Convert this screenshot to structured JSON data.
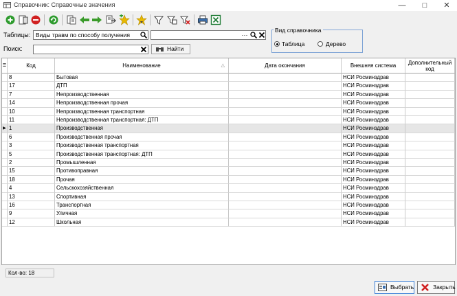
{
  "window": {
    "title": "Справочник: Справочные значения",
    "controls": [
      "minimize",
      "maximize",
      "close"
    ]
  },
  "toolbar": {
    "buttons": [
      "add-icon",
      "edit-icon",
      "delete-icon",
      "refresh-icon",
      "copy-icon",
      "arrow-left-icon",
      "arrow-right-icon",
      "export-icon",
      "star-add-icon",
      "star-down-icon",
      "filter-icon",
      "filter-edit-icon",
      "filter-clear-icon",
      "print-icon",
      "excel-icon"
    ]
  },
  "filters": {
    "table_label": "Таблицы:",
    "table_value": "Виды травм по способу получения",
    "second_value": "",
    "search_label": "Поиск:",
    "search_value": "",
    "find_button": "Найти"
  },
  "view_mode": {
    "title": "Вид справочника",
    "options": [
      "Таблица",
      "Дерево"
    ],
    "selected": "Таблица"
  },
  "grid": {
    "columns": [
      "Код",
      "Наименование",
      "Дата окончания",
      "Внешняя система",
      "Дополнительный код"
    ],
    "sort_column": "Наименование",
    "selected_row": 6,
    "rows": [
      [
        "8",
        "Бытовая",
        "",
        "НСИ Росминздрав",
        ""
      ],
      [
        "17",
        "ДТП",
        "",
        "НСИ Росминздрав",
        ""
      ],
      [
        "7",
        "Непроизводственная",
        "",
        "НСИ Росминздрав",
        ""
      ],
      [
        "14",
        "Непроизводственная прочая",
        "",
        "НСИ Росминздрав",
        ""
      ],
      [
        "10",
        "Непроизводственная транспортная",
        "",
        "НСИ Росминздрав",
        ""
      ],
      [
        "11",
        "Непроизводственная транспортная: ДТП",
        "",
        "НСИ Росминздрав",
        ""
      ],
      [
        "1",
        "Производственная",
        "",
        "НСИ Росминздрав",
        ""
      ],
      [
        "6",
        "Производственная прочая",
        "",
        "НСИ Росминздрав",
        ""
      ],
      [
        "3",
        "Производственная транспортная",
        "",
        "НСИ Росминздрав",
        ""
      ],
      [
        "5",
        "Производственная транспортная: ДТП",
        "",
        "НСИ Росминздрав",
        ""
      ],
      [
        "2",
        "Промышленная",
        "",
        "НСИ Росминздрав",
        ""
      ],
      [
        "15",
        "Противоправная",
        "",
        "НСИ Росминздрав",
        ""
      ],
      [
        "18",
        "Прочая",
        "",
        "НСИ Росминздрав",
        ""
      ],
      [
        "4",
        "Сельскохозяйственная",
        "",
        "НСИ Росминздрав",
        ""
      ],
      [
        "13",
        "Спортивная",
        "",
        "НСИ Росминздрав",
        ""
      ],
      [
        "16",
        "Транспортная",
        "",
        "НСИ Росминздрав",
        ""
      ],
      [
        "9",
        "Уличная",
        "",
        "НСИ Росминздрав",
        ""
      ],
      [
        "12",
        "Школьная",
        "",
        "НСИ Росминздрав",
        ""
      ]
    ]
  },
  "status": {
    "count_label": "Кол-во: 18"
  },
  "buttons": {
    "select": "Выбрать",
    "close": "Закрыть"
  },
  "colors": {
    "accent": "#3c7fd6",
    "add": "#2e9b2e",
    "delete": "#d02020",
    "arrows": "#3a9b2a",
    "star": "#e8b800"
  }
}
